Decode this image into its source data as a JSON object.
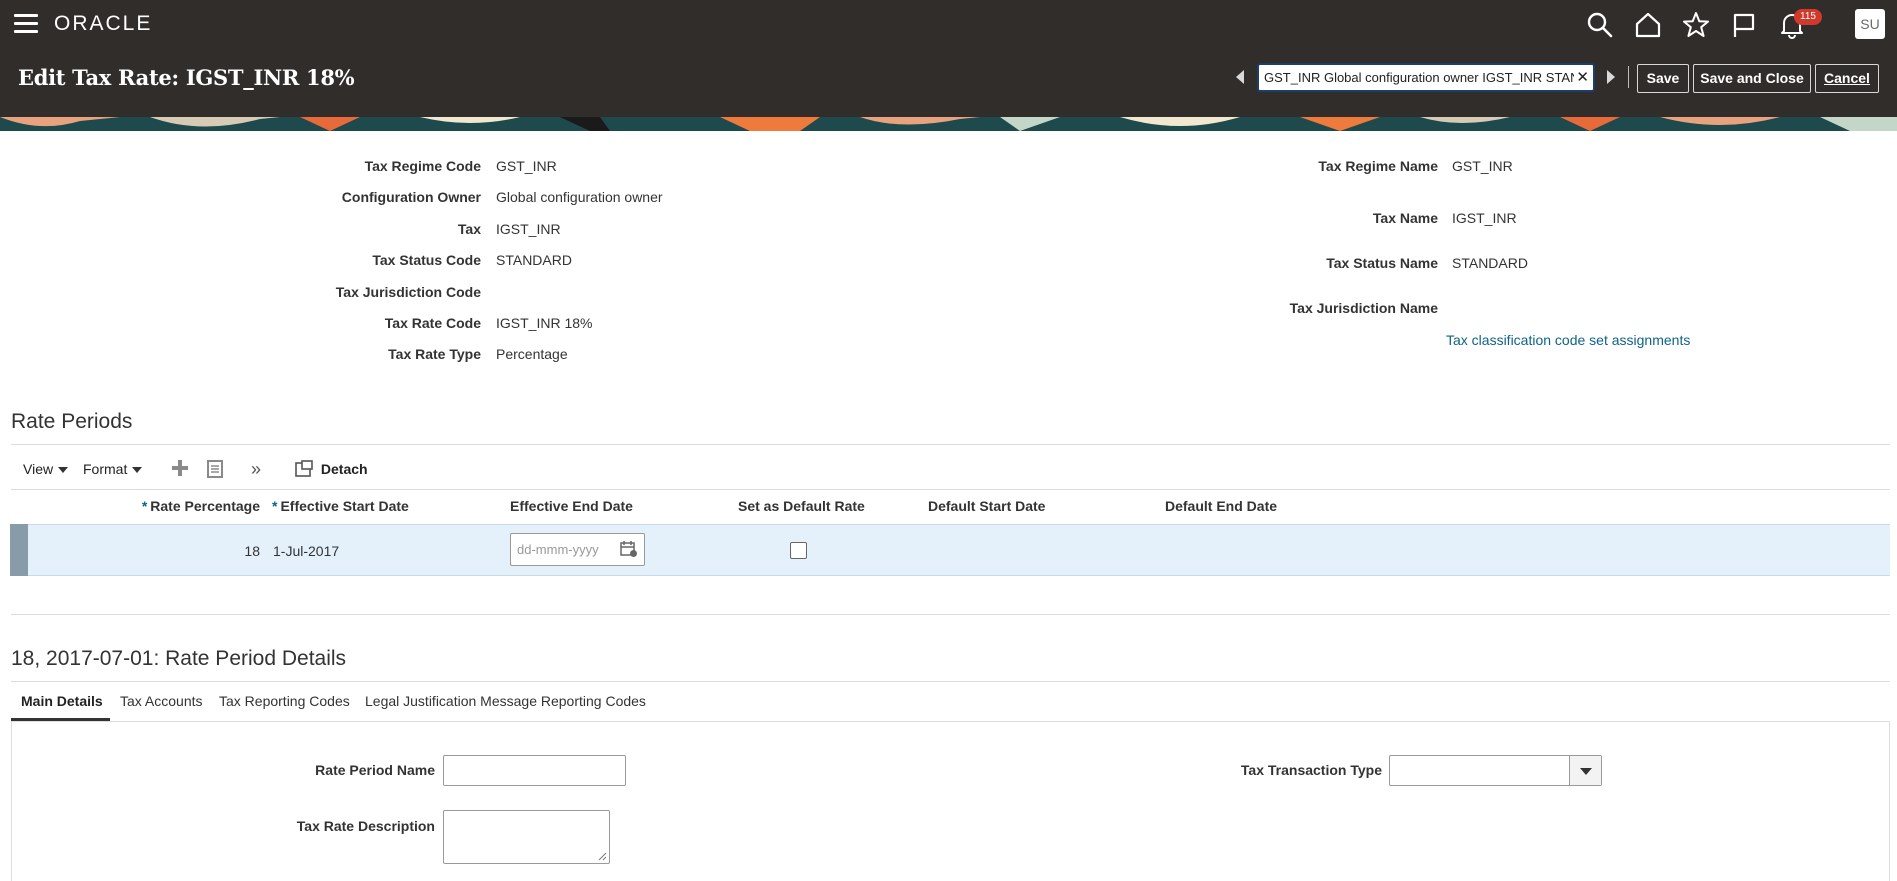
{
  "app": {
    "logo_text": "ORACLE",
    "page_title": "Edit Tax Rate: IGST_INR 18%",
    "notifications_count": "115",
    "user_initials": "SU",
    "record_navigator_value": "GST_INR Global configuration owner IGST_INR STAN",
    "buttons": {
      "save": "Save",
      "save_and_close": "Save and Close",
      "cancel": "Cancel"
    },
    "icons": [
      "menu-icon",
      "search-icon",
      "home-icon",
      "star-icon",
      "flag-icon",
      "bell-icon"
    ]
  },
  "summary": {
    "left": [
      {
        "label": "Tax Regime Code",
        "value": "GST_INR"
      },
      {
        "label": "Configuration Owner",
        "value": "Global configuration owner"
      },
      {
        "label": "Tax",
        "value": "IGST_INR"
      },
      {
        "label": "Tax Status Code",
        "value": "STANDARD"
      },
      {
        "label": "Tax Jurisdiction Code",
        "value": ""
      },
      {
        "label": "Tax Rate Code",
        "value": "IGST_INR 18%"
      },
      {
        "label": "Tax Rate Type",
        "value": "Percentage"
      }
    ],
    "right": [
      {
        "label": "Tax Regime Name",
        "value": "GST_INR"
      },
      {
        "label": "Tax Name",
        "value": "IGST_INR"
      },
      {
        "label": "Tax Status Name",
        "value": "STANDARD"
      },
      {
        "label": "Tax Jurisdiction Name",
        "value": ""
      }
    ],
    "classification_link": "Tax classification code set assignments"
  },
  "rate_periods": {
    "title": "Rate Periods",
    "toolbar": {
      "view": "View",
      "format": "Format",
      "detach": "Detach"
    },
    "columns": [
      "Rate Percentage",
      "Effective Start Date",
      "Effective End Date",
      "Set as Default Rate",
      "Default Start Date",
      "Default End Date"
    ],
    "rows": [
      {
        "rate_percentage": "18",
        "effective_start_date": "1-Jul-2017",
        "effective_end_date_placeholder": "dd-mmm-yyyy",
        "default_rate": false
      }
    ]
  },
  "details": {
    "title": "18, 2017-07-01: Rate Period Details",
    "tabs": [
      "Main Details",
      "Tax Accounts",
      "Tax Reporting Codes",
      "Legal Justification Message Reporting Codes"
    ],
    "active_tab": "Main Details",
    "fields": {
      "rate_period_name_label": "Rate Period Name",
      "tax_rate_description_label": "Tax Rate Description",
      "tax_transaction_type_label": "Tax Transaction Type"
    }
  },
  "colors": {
    "header_bg": "#312d2a",
    "link": "#0f6389",
    "row_selected": "#e4f0fa",
    "badge": "#d0392b"
  }
}
